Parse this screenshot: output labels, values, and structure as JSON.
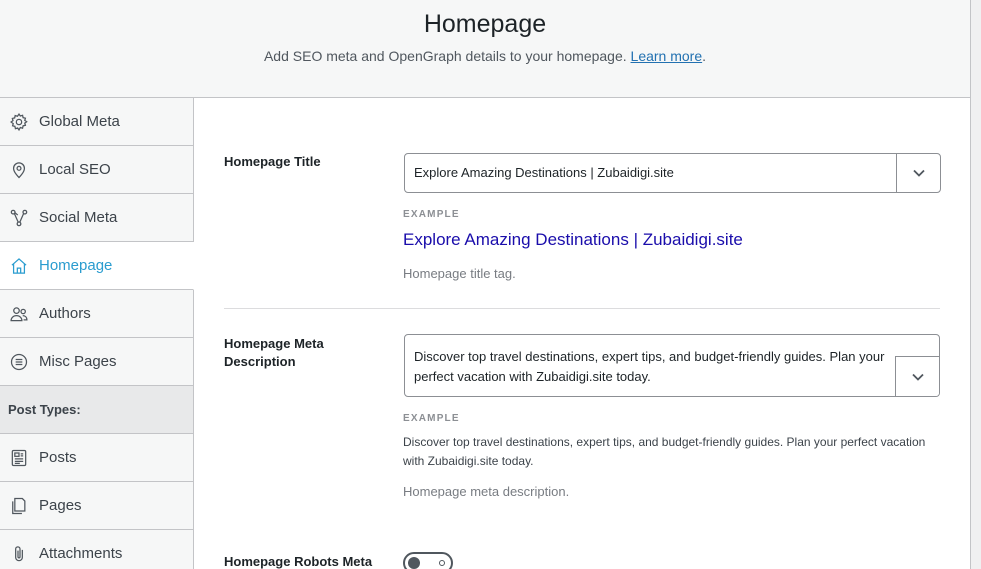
{
  "header": {
    "title": "Homepage",
    "subtitle": "Add SEO meta and OpenGraph details to your homepage.",
    "learn_more": "Learn more",
    "period": "."
  },
  "sidebar": {
    "items": [
      {
        "label": "Global Meta",
        "icon": "gear-icon"
      },
      {
        "label": "Local SEO",
        "icon": "map-pin-icon"
      },
      {
        "label": "Social Meta",
        "icon": "share-nodes-icon"
      },
      {
        "label": "Homepage",
        "icon": "home-icon",
        "active": true
      },
      {
        "label": "Authors",
        "icon": "users-icon"
      },
      {
        "label": "Misc Pages",
        "icon": "list-circle-icon"
      },
      {
        "label": "Post Types:",
        "section": true
      },
      {
        "label": "Posts",
        "icon": "document-icon"
      },
      {
        "label": "Pages",
        "icon": "pages-icon"
      },
      {
        "label": "Attachments",
        "icon": "paperclip-icon"
      }
    ]
  },
  "homepage_title": {
    "label": "Homepage Title",
    "value": "Explore Amazing Destinations | Zubaidigi.site",
    "example_tag": "EXAMPLE",
    "preview": "Explore Amazing Destinations | Zubaidigi.site",
    "help": "Homepage title tag."
  },
  "homepage_meta": {
    "label_line1": "Homepage Meta",
    "label_line2": "Description",
    "value_line1": "Discover top travel destinations, expert tips, and budget-friendly guides. Plan your",
    "value_line2": "perfect vacation with Zubaidigi.site today.",
    "example_tag": "EXAMPLE",
    "preview": "Discover top travel destinations, expert tips, and budget-friendly guides. Plan your perfect vacation with Zubaidigi.site today.",
    "help": "Homepage meta description."
  },
  "homepage_robots": {
    "label": "Homepage Robots Meta"
  },
  "colors": {
    "accent": "#2a9ccf",
    "link": "#2271b1",
    "preview_title": "#1a0dab"
  }
}
